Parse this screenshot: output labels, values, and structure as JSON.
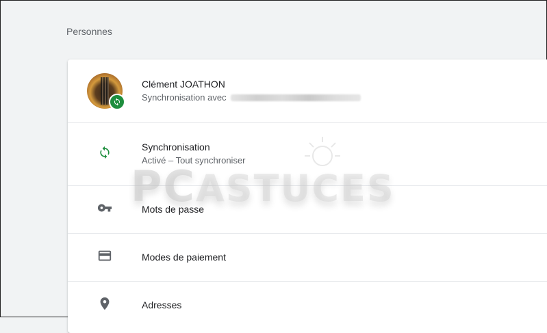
{
  "section": {
    "title": "Personnes"
  },
  "profile": {
    "name": "Clément JOATHON",
    "sync_prefix": "Synchronisation avec"
  },
  "items": [
    {
      "label": "Synchronisation",
      "subtitle": "Activé – Tout synchroniser",
      "icon": "sync-icon"
    },
    {
      "label": "Mots de passe",
      "icon": "key-icon"
    },
    {
      "label": "Modes de paiement",
      "icon": "credit-card-icon"
    },
    {
      "label": "Adresses",
      "icon": "location-pin-icon"
    }
  ],
  "watermark": {
    "pc": "PC",
    "astuces": "ASTUCES"
  },
  "colors": {
    "sync_green": "#1e8e3e",
    "icon_gray": "#5f6368",
    "text_primary": "#202124",
    "background": "#f1f3f4"
  }
}
